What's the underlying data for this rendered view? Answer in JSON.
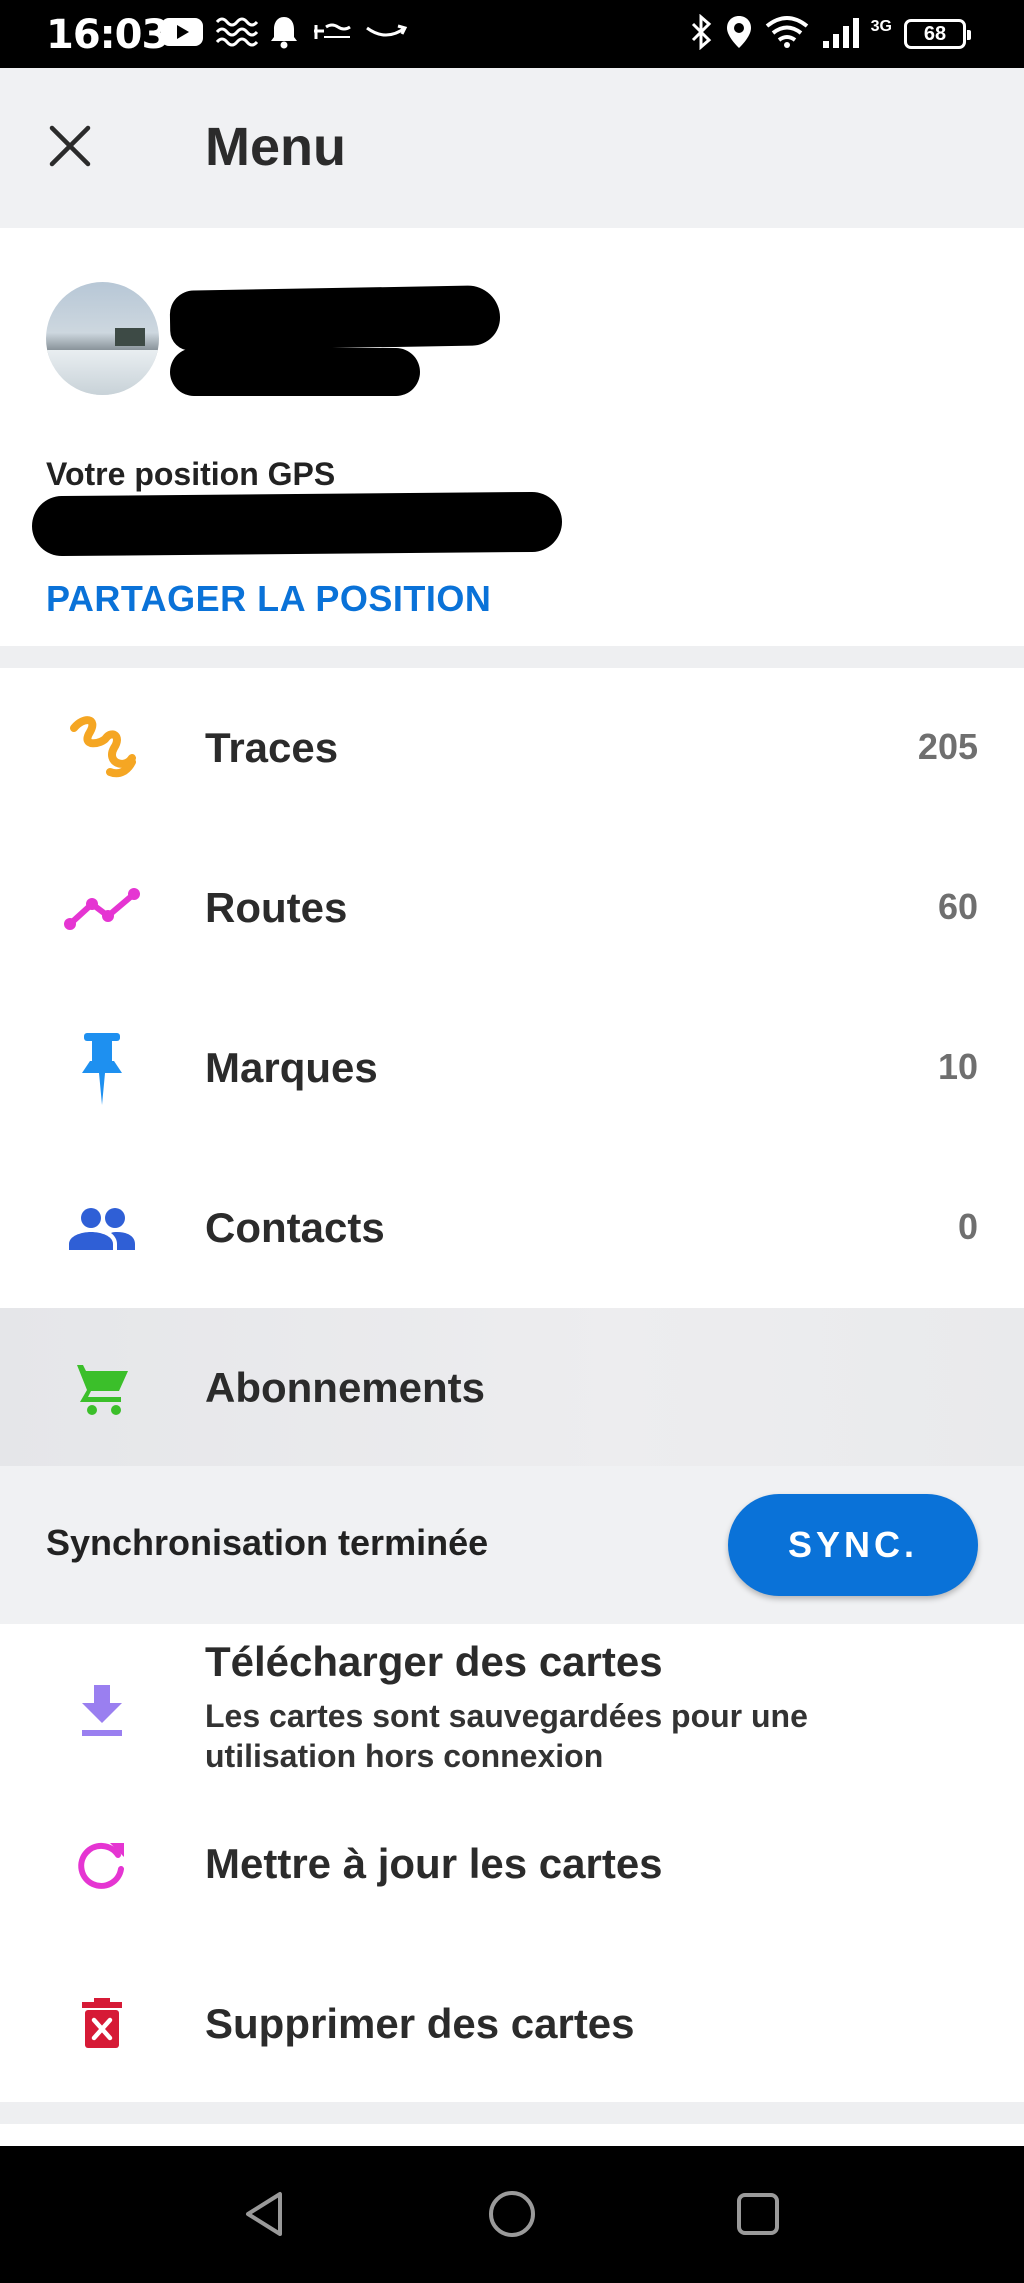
{
  "status_bar": {
    "time": "16:03",
    "left_icons": [
      "youtube-icon",
      "waves-icon",
      "bell-icon",
      "intermarche-icon",
      "amazon-icon"
    ],
    "right_icons": [
      "bluetooth-icon",
      "location-icon",
      "wifi-icon",
      "signal-icon"
    ],
    "network": "3G",
    "battery": "68"
  },
  "header": {
    "title": "Menu",
    "close_icon": "close-icon"
  },
  "profile": {
    "gps_label": "Votre position GPS",
    "share_label": "PARTAGER LA POSITION"
  },
  "menu": {
    "items": [
      {
        "label": "Traces",
        "count": "205",
        "icon": "traces-icon",
        "color": "#f5a623"
      },
      {
        "label": "Routes",
        "count": "60",
        "icon": "routes-icon",
        "color": "#e535d2"
      },
      {
        "label": "Marques",
        "count": "10",
        "icon": "pushpin-icon",
        "color": "#1e90f0"
      },
      {
        "label": "Contacts",
        "count": "0",
        "icon": "contacts-icon",
        "color": "#2f5fd6"
      },
      {
        "label": "Abonnements",
        "count": "",
        "icon": "cart-icon",
        "color": "#3bbf2a"
      }
    ]
  },
  "sync": {
    "status": "Synchronisation terminée",
    "button": "SYNC."
  },
  "maps": {
    "download_title": "Télécharger des cartes",
    "download_desc": "Les cartes sont sauvegardées pour une utilisation hors connexion",
    "update_label": "Mettre à jour les cartes",
    "delete_label": "Supprimer des cartes"
  },
  "colors": {
    "accent": "#0a72d8",
    "header_bg": "#f0f1f3",
    "download_icon": "#9a7ff0",
    "update_icon": "#e535d2",
    "delete_icon": "#d61a36"
  }
}
